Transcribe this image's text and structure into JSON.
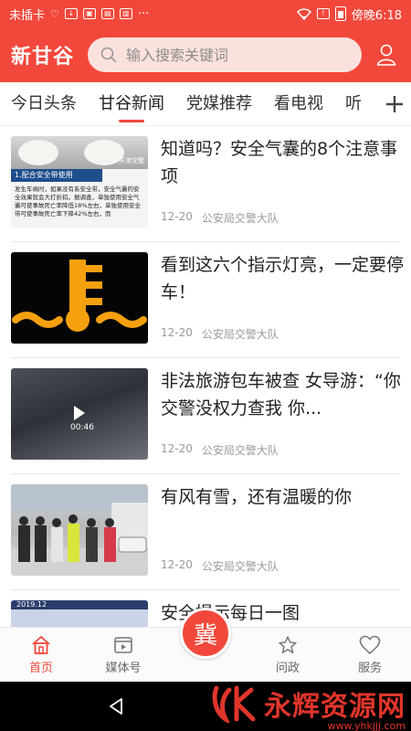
{
  "status_bar": {
    "carrier": "未插卡",
    "time": "傍晚6:18",
    "more": "···"
  },
  "header": {
    "logo": "新甘谷",
    "search_placeholder": "输入搜索关键词"
  },
  "tabs": [
    {
      "label": "今日头条",
      "active": false
    },
    {
      "label": "甘谷新闻",
      "active": true
    },
    {
      "label": "党媒推荐",
      "active": false
    },
    {
      "label": "看电视",
      "active": false
    },
    {
      "label": "听",
      "active": false
    }
  ],
  "articles": [
    {
      "title": "知道吗？安全气囊的8个注意事项",
      "date": "12-20",
      "source": "公安局交警大队",
      "thumb_caption": "1.配合安全带使用",
      "thumb_watermark": "天津交警",
      "thumb_body": "发生车祸时，如果没有系安全带，安全气囊的安全效果就会大打折扣。据调查，单独使用安全气囊可使事故死亡率降低18%左右，单独使用安全带可使事故死亡率下降42%左右，而"
    },
    {
      "title": "看到这六个指示灯亮，一定要停车！",
      "date": "12-20",
      "source": "公安局交警大队"
    },
    {
      "title": "非法旅游包车被查 女导游：“你交警没权力查我 你...",
      "date": "12-20",
      "source": "公安局交警大队",
      "duration": "00:46"
    },
    {
      "title": "有风有雪，还有温暖的你",
      "date": "12-20",
      "source": "公安局交警大队"
    },
    {
      "title": "安全提示每日一图",
      "thumb_caption": "2019.12"
    }
  ],
  "bottom_nav": [
    {
      "label": "首页",
      "icon": "home-icon",
      "active": true
    },
    {
      "label": "媒体号",
      "icon": "video-icon",
      "active": false
    },
    {
      "label": "冀",
      "icon": "center-logo",
      "active": false
    },
    {
      "label": "问政",
      "icon": "star-icon",
      "active": false
    },
    {
      "label": "服务",
      "icon": "heart-icon",
      "active": false
    }
  ],
  "watermark": {
    "text": "永辉资源网",
    "url": "www.yhkjjj.com"
  },
  "colors": {
    "brand": "#f2483b",
    "text": "#222222",
    "meta": "#9a9a9a"
  }
}
